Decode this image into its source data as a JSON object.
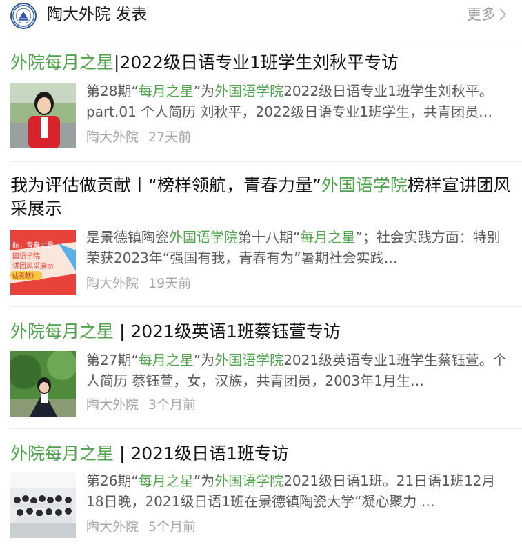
{
  "header": {
    "account_name": "陶大外院 发表",
    "more_label": "更多"
  },
  "articles": [
    {
      "title_parts": [
        {
          "text": "外院每月之星",
          "hl": true
        },
        {
          "text": "|2022级日语专业1班学生刘秋平专访",
          "hl": false
        }
      ],
      "snippet_parts": [
        {
          "text": "第28期“",
          "hl": false
        },
        {
          "text": "每月之星",
          "hl": true
        },
        {
          "text": "”为",
          "hl": false
        },
        {
          "text": "外国语学院",
          "hl": true
        },
        {
          "text": "2022级日语专业1班学生刘秋平。part.01 个人简历 刘秋平，2022级日语专业1班学生，共青团员…",
          "hl": false
        }
      ],
      "source": "陶大外院",
      "time": "27天前",
      "thumb": "student-portrait-red-vest"
    },
    {
      "title_parts": [
        {
          "text": "我为评估做贡献丨“榜样领航，青春力量”",
          "hl": false
        },
        {
          "text": "外国语学院",
          "hl": true
        },
        {
          "text": "榜样宣讲团风采展示",
          "hl": false
        }
      ],
      "snippet_parts": [
        {
          "text": "是景德镇陶瓷",
          "hl": false
        },
        {
          "text": "外国语学院",
          "hl": true
        },
        {
          "text": "第十八期“",
          "hl": false
        },
        {
          "text": "每月之星",
          "hl": true
        },
        {
          "text": "”；社会实践方面：特别荣获2023年“强国有我，青春有为”暑期社会实践…",
          "hl": false
        }
      ],
      "source": "陶大外院",
      "time": "19天前",
      "thumb": "poster-graphic",
      "thumb_texts": [
        "航，青春力量",
        "国语学院",
        "讲团风采展示",
        "估贡献》"
      ]
    },
    {
      "title_parts": [
        {
          "text": "外院每月之星",
          "hl": true
        },
        {
          "text": " | 2021级英语1班蔡钰萱专访",
          "hl": false
        }
      ],
      "snippet_parts": [
        {
          "text": "第27期“",
          "hl": false
        },
        {
          "text": "每月之星",
          "hl": true
        },
        {
          "text": "”为",
          "hl": false
        },
        {
          "text": "外国语学院",
          "hl": true
        },
        {
          "text": "2021级英语专业1班学生蔡钰萱。个人简历 蔡钰萱，女，汉族，共青团员，2003年1月生…",
          "hl": false
        }
      ],
      "source": "陶大外院",
      "time": "3个月前",
      "thumb": "student-portrait-trees"
    },
    {
      "title_parts": [
        {
          "text": "外院每月之星",
          "hl": true
        },
        {
          "text": " | 2021级日语1班专访",
          "hl": false
        }
      ],
      "snippet_parts": [
        {
          "text": "第26期“",
          "hl": false
        },
        {
          "text": "每月之星",
          "hl": true
        },
        {
          "text": "”为",
          "hl": false
        },
        {
          "text": "外国语学院",
          "hl": true
        },
        {
          "text": "2021级日语1班。21日语1班12月18日晚，2021级日语1班在景德镇陶瓷大学“凝心聚力 …",
          "hl": false
        }
      ],
      "source": "陶大外院",
      "time": "5个月前",
      "thumb": "class-group-photo"
    }
  ],
  "colors": {
    "highlight": "#4fa34b",
    "title": "#111111",
    "snippet": "#5a5a5a",
    "meta": "#a8a8a8"
  }
}
